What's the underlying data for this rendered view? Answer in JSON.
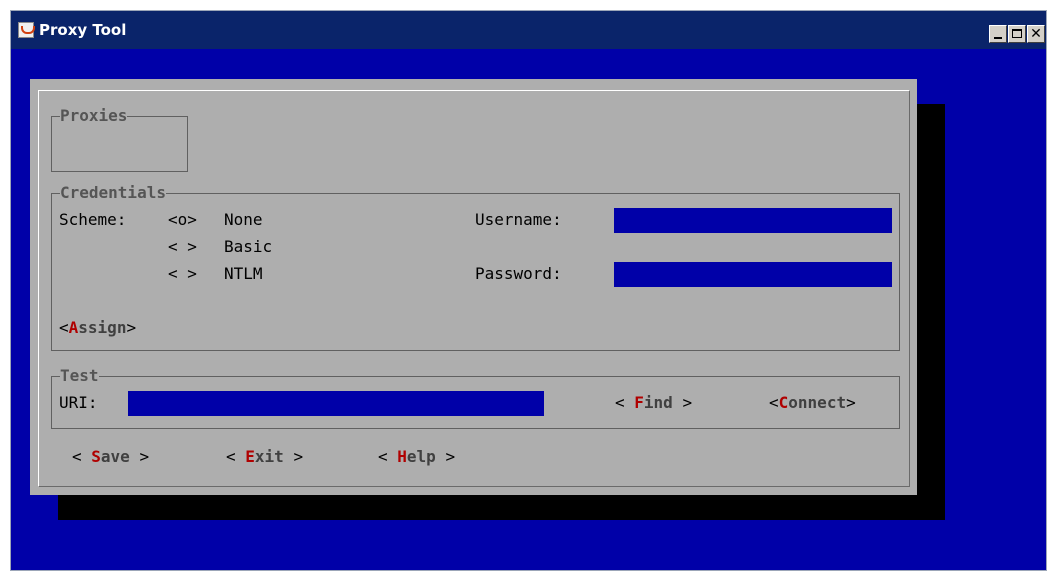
{
  "window": {
    "title": "Proxy Tool"
  },
  "proxies": {
    "title": "Proxies"
  },
  "credentials": {
    "title": "Credentials",
    "scheme_label": "Scheme:",
    "options": [
      {
        "marker": "<o>",
        "label": "None"
      },
      {
        "marker": "< >",
        "label": "Basic"
      },
      {
        "marker": "< >",
        "label": "NTLM"
      }
    ],
    "username_label": "Username:",
    "username_value": "",
    "password_label": "Password:",
    "password_value": "",
    "assign": {
      "open": "<",
      "hotkey": "A",
      "rest": "ssign",
      "close": ">"
    }
  },
  "test": {
    "title": "Test",
    "uri_label": "URI:",
    "uri_value": "",
    "find": {
      "open": "< ",
      "hotkey": "F",
      "rest": "ind",
      "close": " >"
    },
    "connect": {
      "open": "<",
      "hotkey": "C",
      "rest": "onnect",
      "close": ">"
    }
  },
  "footer": {
    "save": {
      "open": "< ",
      "hotkey": "S",
      "rest": "ave",
      "close": " >"
    },
    "exit": {
      "open": "< ",
      "hotkey": "E",
      "rest": "xit",
      "close": " >"
    },
    "help": {
      "open": "< ",
      "hotkey": "H",
      "rest": "elp",
      "close": " >"
    }
  },
  "colors": {
    "background": "#0000a8",
    "dialog": "#aeaeae",
    "field": "#0000a8",
    "hotkey": "#b00000"
  }
}
